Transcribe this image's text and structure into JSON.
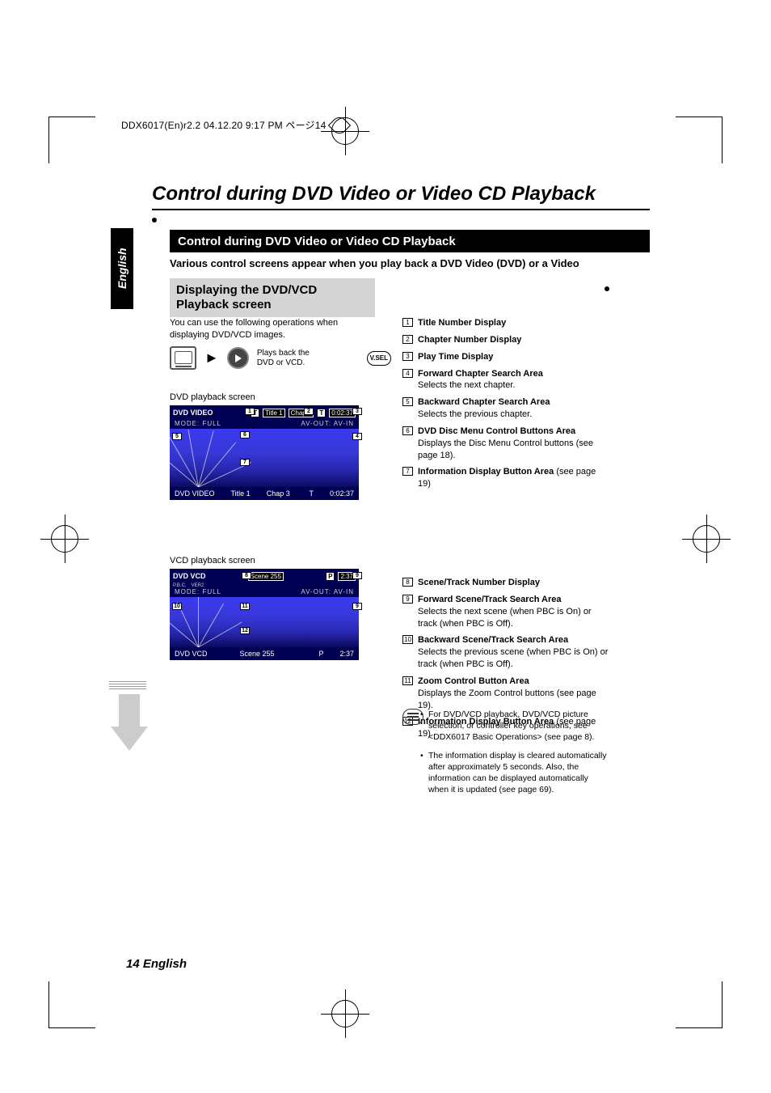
{
  "meta": {
    "header": "DDX6017(En)r2.2  04.12.20  9:17 PM  ページ14"
  },
  "page": {
    "title": "Control during DVD Video or Video CD Playback",
    "section_bar": "Control during DVD Video or Video CD Playback",
    "subtitle": "Various control screens appear when you play back a DVD Video (DVD) or a Video",
    "lang_tab": "English",
    "footer": "14 English"
  },
  "dvd_section": {
    "heading": "Displaying the DVD/VCD Playback screen",
    "intro": "You can use the following operations when displaying DVD/VCD images.",
    "play_text": "Plays back the DVD or VCD.",
    "vsel": "V.SEL",
    "caption_dvd": "DVD playback screen",
    "caption_vcd": "VCD playback screen"
  },
  "dvd_screen": {
    "src_top": "DVD VIDEO",
    "title_tag": "T",
    "title_val": "Title 1",
    "chap_val": "Chap 3",
    "time_tag": "T",
    "time_val": "0:02:37",
    "mode_l": "MODE: FULL",
    "mode_r": "AV-OUT: AV-IN",
    "src_bot": "DVD VIDEO",
    "bot_title": "Title 1",
    "bot_chap": "Chap 3",
    "bot_t": "T",
    "bot_time": "0:02:37"
  },
  "vcd_screen": {
    "src_top": "DVD VCD",
    "pbc": "P.B.C.",
    "ver": "VER2",
    "scene_val": "Scene 255",
    "time_tag": "P",
    "time_val": "2:37",
    "mode_l": "MODE: FULL",
    "mode_r": "AV-OUT: AV-IN",
    "src_bot": "DVD VCD",
    "bot_scene": "Scene 255",
    "bot_p": "P",
    "bot_time": "2:37"
  },
  "legend_dvd": {
    "i1": {
      "n": "1",
      "b": "Title Number Display"
    },
    "i2": {
      "n": "2",
      "b": "Chapter Number Display"
    },
    "i3": {
      "n": "3",
      "b": "Play Time Display"
    },
    "i4": {
      "n": "4",
      "b": "Forward Chapter Search Area",
      "d": "Selects the next chapter."
    },
    "i5": {
      "n": "5",
      "b": "Backward Chapter Search Area",
      "d": "Selects the previous chapter."
    },
    "i6": {
      "n": "6",
      "b": "DVD Disc Menu Control Buttons Area",
      "d": "Displays the Disc Menu Control buttons (see page 18)."
    },
    "i7": {
      "n": "7",
      "b": "Information Display Button Area",
      "d2": " (see page 19)"
    }
  },
  "legend_vcd": {
    "i8": {
      "n": "8",
      "b": "Scene/Track Number Display"
    },
    "i9": {
      "n": "9",
      "b": "Forward Scene/Track Search Area",
      "d": "Selects the next scene (when PBC is On) or track (when PBC is Off)."
    },
    "i10": {
      "n": "10",
      "b": "Backward Scene/Track Search Area",
      "d": "Selects the previous scene (when PBC is On) or track (when PBC is Off)."
    },
    "i11": {
      "n": "11",
      "b": "Zoom Control Button Area",
      "d": "Displays the Zoom Control buttons (see page 19)."
    },
    "i12": {
      "n": "12",
      "b": "Information Display Button Area",
      "d2": " (see page 19)"
    }
  },
  "notes": {
    "n1": "For DVD/VCD playback, DVD/VCD picture selection, or controller key operations, see <DDX6017 Basic Operations> (see page 8).",
    "n2": "The information display is cleared automatically after approximately 5 seconds. Also, the information can be displayed automatically when it is updated (see page 69)."
  },
  "callouts": {
    "c1": "1",
    "c2": "2",
    "c3": "3",
    "c4": "4",
    "c5": "5",
    "c6": "6",
    "c7": "7",
    "c8": "8",
    "c9": "9",
    "c10": "10",
    "c11": "11",
    "c12": "12"
  }
}
